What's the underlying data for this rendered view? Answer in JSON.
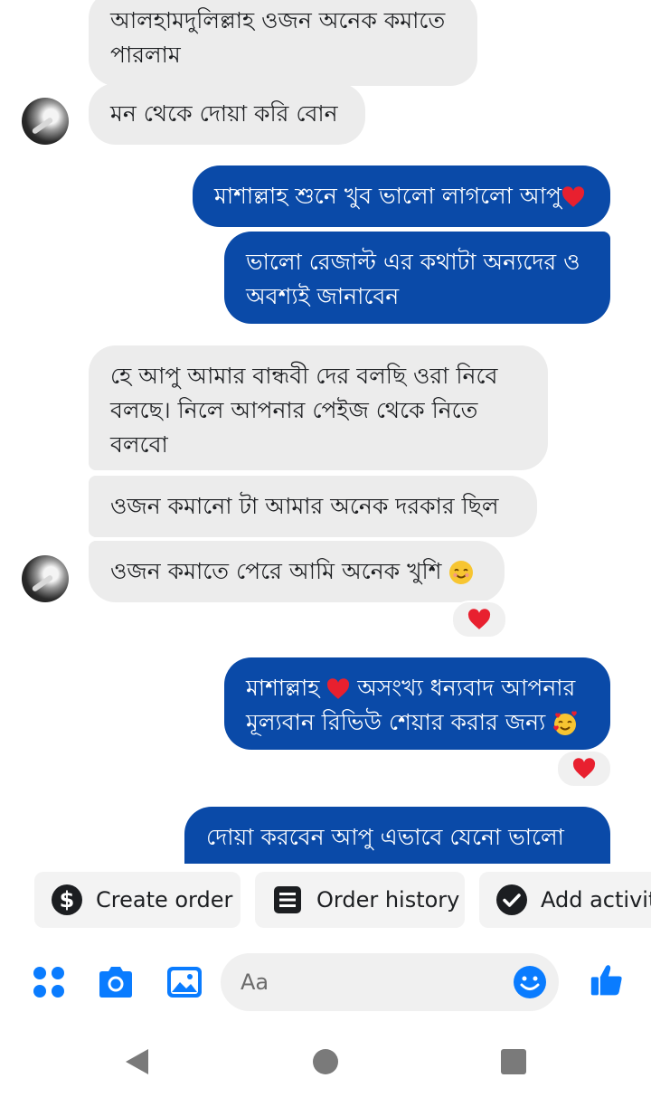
{
  "conversation": {
    "messages": [
      {
        "side": "in",
        "text": "আলহামদুলিল্লাহ ওজন অনেক কমাতে পারলাম"
      },
      {
        "side": "in",
        "text": "মন থেকে দোয়া করি বোন"
      },
      {
        "side": "out",
        "text": "মাশাল্লাহ শুনে খুব ভালো লাগলো আপু",
        "emoji": "heart"
      },
      {
        "side": "out",
        "text": "ভালো রেজাল্ট এর কথাটা অন্যদের ও অবশ্যই জানাবেন"
      },
      {
        "side": "in",
        "text": "হে আপু আমার বান্ধবী দের বলছি ওরা নিবে বলছে। নিলে আপনার পেইজ থেকে নিতে বলবো"
      },
      {
        "side": "in",
        "text": "ওজন কমানো টা আমার অনেক দরকার ছিল"
      },
      {
        "side": "in",
        "text": "ওজন কমাতে পেরে আমি অনেক খুশি",
        "emoji": "smiling-face",
        "reaction": "heart"
      },
      {
        "side": "out",
        "text_part1": "মাশাল্লাহ",
        "text_part2": "অসংখ্য ধন্যবাদ আপনার মূল্যবান রিভিউ শেয়ার করার জন্য",
        "emoji": "smiling-face-with-hearts",
        "reaction": "heart"
      },
      {
        "side": "out",
        "text": "দোয়া করবেন আপু এভাবে যেনো ভালো"
      }
    ]
  },
  "quick_actions": [
    {
      "label": "Create order",
      "icon": "dollar-icon"
    },
    {
      "label": "Order history",
      "icon": "list-icon"
    },
    {
      "label": "Add activit",
      "icon": "check-circle-icon"
    }
  ],
  "composer": {
    "placeholder": "Aa",
    "icons": [
      "apps-icon",
      "camera-icon",
      "gallery-icon",
      "emoji-icon",
      "like-icon"
    ]
  },
  "colors": {
    "outgoing_bubble": "#0a4aa8",
    "incoming_bubble": "#ececec",
    "accent": "#0a7cff",
    "heart": "#e8202f"
  },
  "system_nav": [
    "back-icon",
    "home-icon",
    "recents-icon"
  ]
}
